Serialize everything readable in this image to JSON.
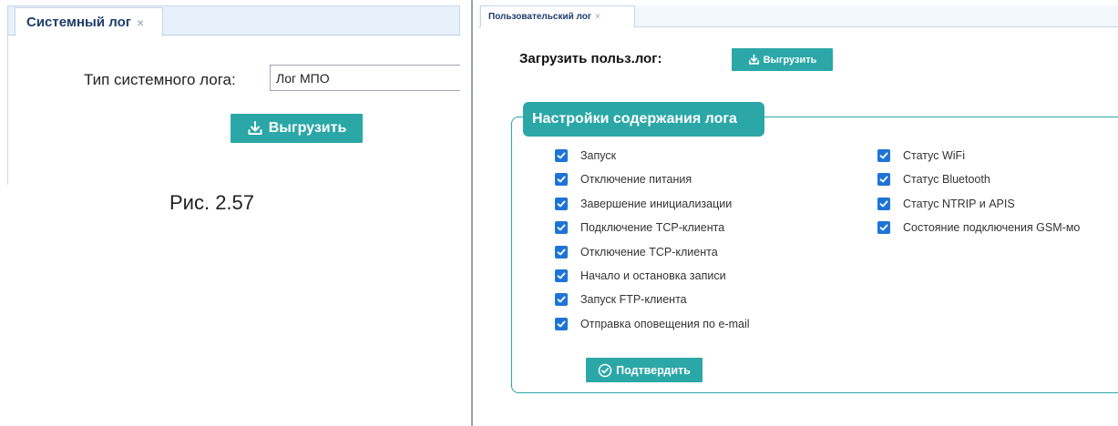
{
  "system_log_panel": {
    "tab_title": "Системный лог",
    "tab_close": "×",
    "type_label": "Тип системного лога:",
    "type_value": "Лог МПО",
    "export_label": "Выгрузить"
  },
  "caption": "Рис. 2.57",
  "user_log_panel": {
    "tab_title": "Пользовательский лог",
    "tab_close": "×",
    "load_label": "Загрузить польз.лог:",
    "export_label": "Выгрузить",
    "settings_title": "Настройки содержания лога",
    "left_options": [
      {
        "label": "Запуск",
        "checked": true
      },
      {
        "label": "Отключение питания",
        "checked": true
      },
      {
        "label": "Завершение инициализации",
        "checked": true
      },
      {
        "label": "Подключение TCP-клиента",
        "checked": true
      },
      {
        "label": "Отключение TCP-клиента",
        "checked": true
      },
      {
        "label": "Начало и остановка записи",
        "checked": true
      },
      {
        "label": "Запуск FTP-клиента",
        "checked": true
      },
      {
        "label": "Отправка оповещения по e-mail",
        "checked": true
      }
    ],
    "right_options": [
      {
        "label": "Статус WiFi",
        "checked": true
      },
      {
        "label": "Статус Bluetooth",
        "checked": true
      },
      {
        "label": "Статус NTRIP и APIS",
        "checked": true
      },
      {
        "label": "Состояние подключения GSM-мо",
        "checked": true
      }
    ],
    "confirm_label": "Подтвердить"
  },
  "colors": {
    "accent": "#2ba7a7",
    "checkbox": "#1e74d6",
    "tab_text": "#1f3d6b"
  },
  "icons": {
    "export": "download-icon",
    "confirm": "check-circle-icon",
    "checkbox": "checkmark-icon"
  }
}
